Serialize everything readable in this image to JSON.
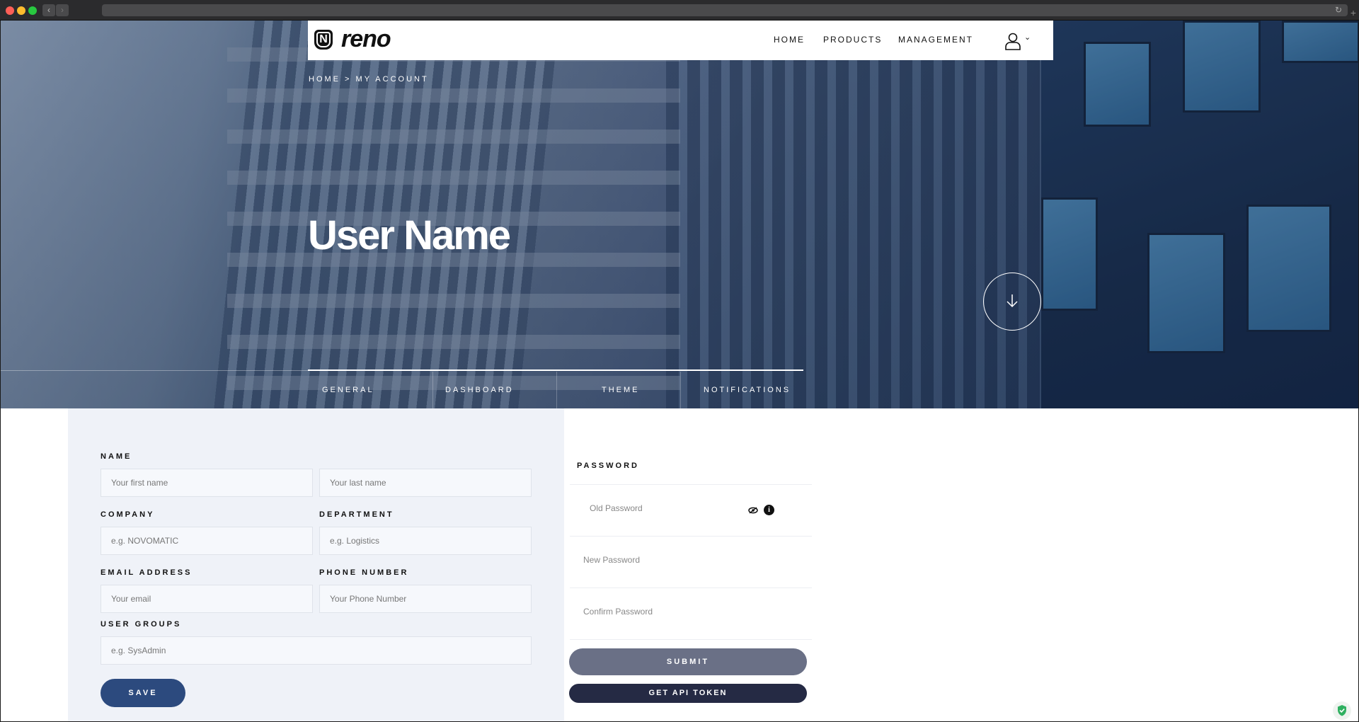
{
  "header": {
    "logo_mark": "N",
    "logo_text": "reno",
    "nav": {
      "home": "HOME",
      "products": "PRODUCTS",
      "management": "MANAGEMENT"
    },
    "user_caret": "⌄"
  },
  "breadcrumb": "HOME  >  MY ACCOUNT",
  "title": "User Name",
  "tabs": {
    "general": "GENERAL",
    "dashboard": "DASHBOARD",
    "theme": "THEME",
    "notifications": "NOTIFICATIONS"
  },
  "form": {
    "name_label": "NAME",
    "first_name_placeholder": "Your first name",
    "last_name_placeholder": "Your last name",
    "company_label": "COMPANY",
    "company_placeholder": "e.g. NOVOMATIC",
    "department_label": "DEPARTMENT",
    "department_placeholder": "e.g. Logistics",
    "email_label": "EMAIL ADDRESS",
    "email_placeholder": "Your email",
    "phone_label": "PHONE NUMBER",
    "phone_placeholder": "Your Phone Number",
    "groups_label": "USER GROUPS",
    "groups_placeholder": "e.g. SysAdmin",
    "save_label": "SAVE"
  },
  "password": {
    "label": "PASSWORD",
    "old_placeholder": "Old Password",
    "new_placeholder": "New Password",
    "confirm_placeholder": "Confirm Password",
    "info_glyph": "i",
    "submit_label": "SUBMIT",
    "api_label": "GET API TOKEN"
  },
  "colors": {
    "save": "#2c4a7e",
    "submit": "#6a7086",
    "api": "#252a44",
    "panel": "#eff2f8"
  }
}
